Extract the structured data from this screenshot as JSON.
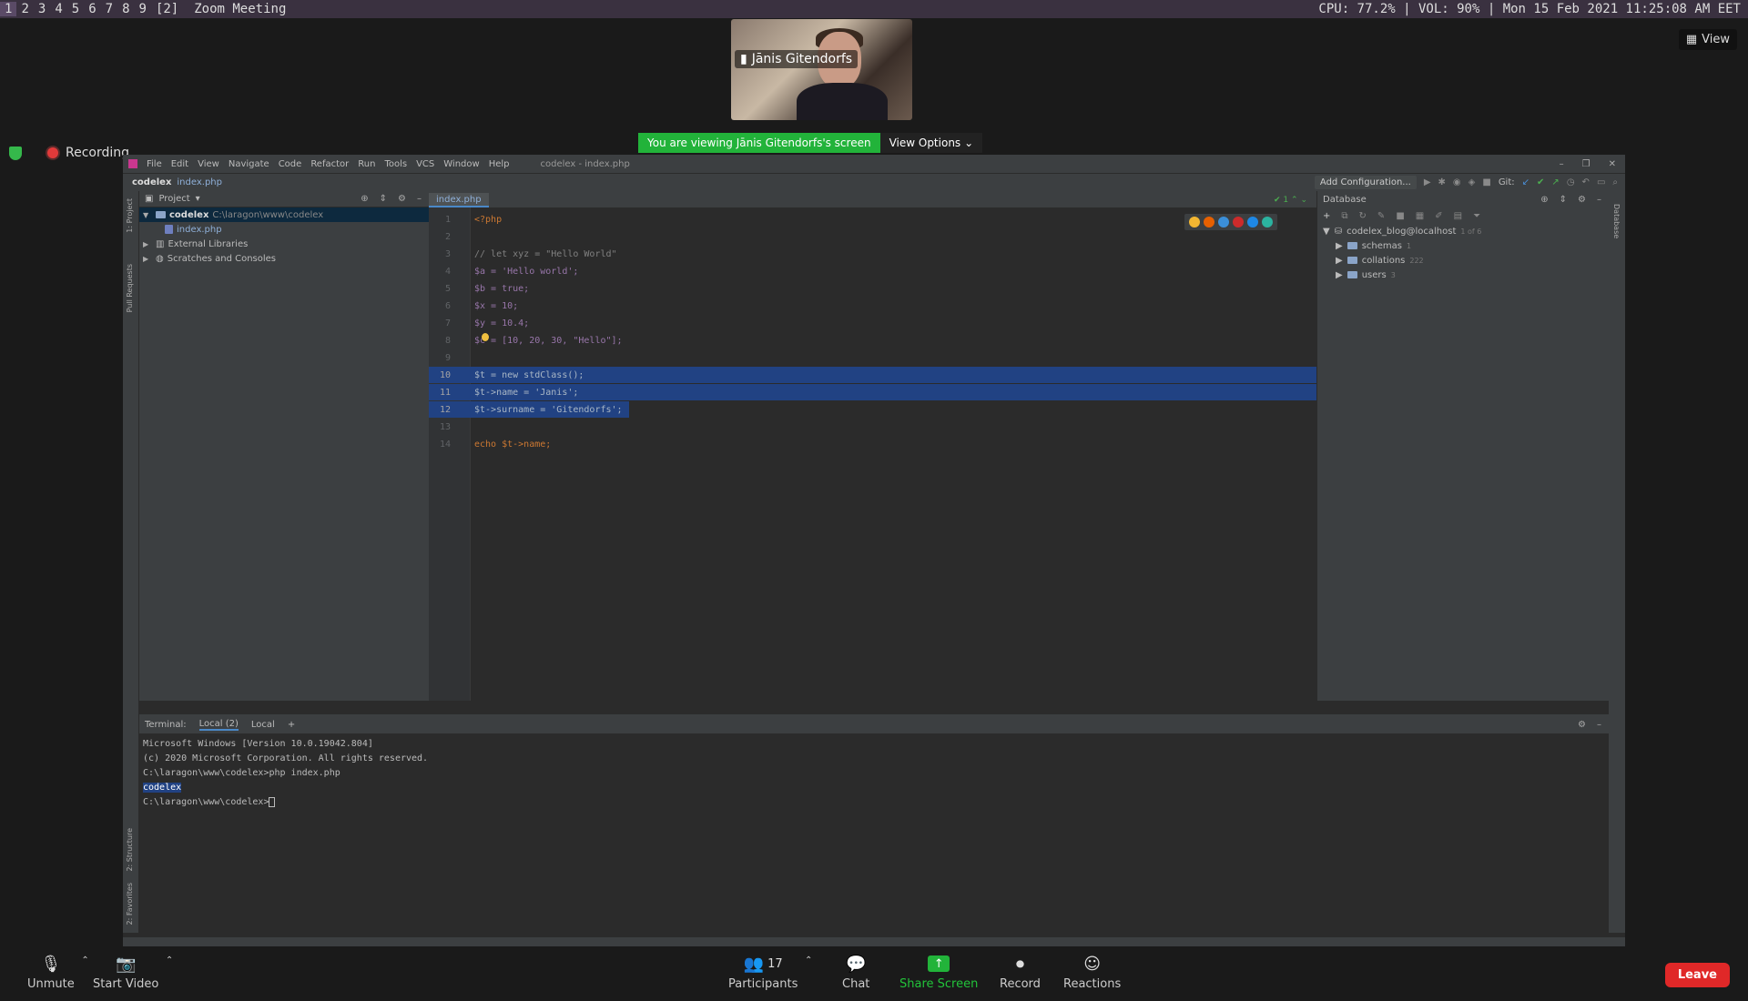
{
  "sysbar": {
    "workspaces": [
      "1",
      "2",
      "3",
      "4",
      "5",
      "6",
      "7",
      "8",
      "9",
      "[2]"
    ],
    "window_title": "Zoom Meeting",
    "status": "CPU: 77.2% | VOL: 90% | Mon 15 Feb 2021 11:25:08 AM EET"
  },
  "zoom": {
    "participant_name": "Jānis Gitendorfs",
    "view_label": "View",
    "recording_label": "Recording",
    "viewing_message": "You are viewing Jānis Gitendorfs's screen",
    "view_options_label": "View Options"
  },
  "ide": {
    "menu": [
      "File",
      "Edit",
      "View",
      "Navigate",
      "Code",
      "Refactor",
      "Run",
      "Tools",
      "VCS",
      "Window",
      "Help"
    ],
    "title": "codelex - index.php",
    "breadcrumb_project": "codelex",
    "breadcrumb_file": "index.php",
    "add_configuration": "Add Configuration...",
    "git_label": "Git:",
    "project_header": "Project",
    "tree": {
      "root_name": "codelex",
      "root_path": "C:\\laragon\\www\\codelex",
      "file": "index.php",
      "external_libraries": "External Libraries",
      "scratches": "Scratches and Consoles"
    },
    "editor_tab": "index.php",
    "inspection_count": "1",
    "code_lines": [
      {
        "n": "1",
        "text": "<?php"
      },
      {
        "n": "2",
        "text": ""
      },
      {
        "n": "3",
        "text": "// let xyz = \"Hello World\""
      },
      {
        "n": "4",
        "text": "$a = 'Hello world';"
      },
      {
        "n": "5",
        "text": "$b = true;"
      },
      {
        "n": "6",
        "text": "$x = 10;"
      },
      {
        "n": "7",
        "text": "$y = 10.4;"
      },
      {
        "n": "8",
        "text": "$c = [10, 20, 30, \"Hello\"];"
      },
      {
        "n": "9",
        "text": ""
      },
      {
        "n": "10",
        "text": "$t = new stdClass();"
      },
      {
        "n": "11",
        "text": "$t->name = 'Janis';"
      },
      {
        "n": "12",
        "text": "$t->surname = 'Gitendorfs';"
      },
      {
        "n": "13",
        "text": ""
      },
      {
        "n": "14",
        "text": "echo $t->name;"
      }
    ],
    "database": {
      "header": "Database",
      "connection": "codelex_blog@localhost",
      "connection_count": "1 of 6",
      "items": [
        {
          "label": "schemas",
          "count": "1"
        },
        {
          "label": "collations",
          "count": "222"
        },
        {
          "label": "users",
          "count": "3"
        }
      ]
    },
    "left_strip": [
      "1: Project",
      "Pull Requests",
      "2: Structure",
      "2: Favorites"
    ],
    "right_strip": "Database",
    "terminal": {
      "label": "Terminal:",
      "tabs": [
        "Local (2)",
        "Local"
      ],
      "lines": [
        "Microsoft Windows [Version 10.0.19042.804]",
        "(c) 2020 Microsoft Corporation. All rights reserved.",
        "C:\\laragon\\www\\codelex>php index.php",
        "codelex",
        "C:\\laragon\\www\\codelex>"
      ]
    }
  },
  "controls": {
    "unmute": "Unmute",
    "start_video": "Start Video",
    "participants": "Participants",
    "participants_count": "17",
    "chat": "Chat",
    "share_screen": "Share Screen",
    "record": "Record",
    "reactions": "Reactions",
    "leave": "Leave"
  },
  "colors": {
    "share_green": "#22b33a",
    "leave_red": "#e02828",
    "selection_blue": "#214283"
  }
}
